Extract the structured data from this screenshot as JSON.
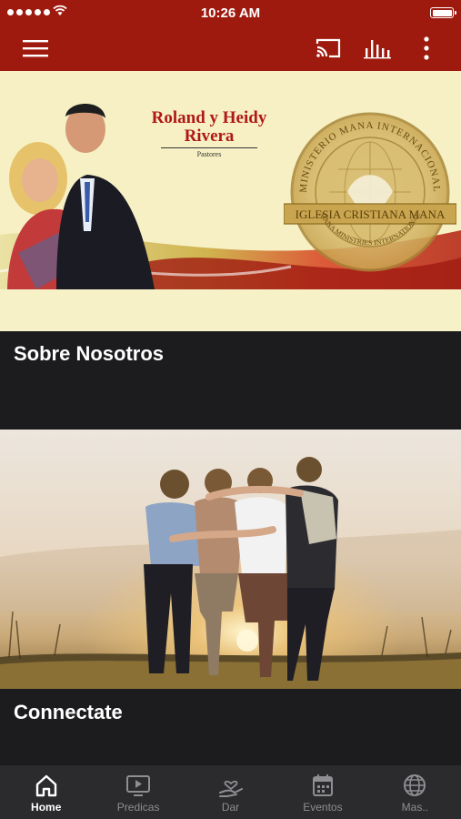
{
  "status_bar": {
    "time": "10:26 AM"
  },
  "app_bar": {
    "icons": [
      "menu-icon",
      "cast-icon",
      "audio-bars-icon",
      "more-vertical-icon"
    ]
  },
  "banner": {
    "names": "Roland y Heidy Rivera",
    "role": "Pastores",
    "seal_top_text": "MINISTERIO MANA INTERNACIONAL",
    "seal_ribbon_text": "IGLESIA CRISTIANA MANA",
    "seal_bottom_text": "MANA MINISTRIES INTERNATIONAL"
  },
  "cards": [
    {
      "title": "Sobre Nosotros"
    },
    {
      "title": "Connectate"
    }
  ],
  "tab_bar": {
    "items": [
      {
        "label": "Home",
        "icon": "home-icon",
        "active": true
      },
      {
        "label": "Predicas",
        "icon": "video-play-icon",
        "active": false
      },
      {
        "label": "Dar",
        "icon": "give-hand-heart-icon",
        "active": false
      },
      {
        "label": "Eventos",
        "icon": "calendar-icon",
        "active": false
      },
      {
        "label": "Mas..",
        "icon": "globe-icon",
        "active": false
      }
    ]
  },
  "colors": {
    "brand_red": "#9e1a0e",
    "dark_background": "#1c1c1e",
    "tab_bar_background": "#2b2b2d",
    "tab_inactive": "#8e8e93",
    "tab_active": "#ffffff"
  }
}
